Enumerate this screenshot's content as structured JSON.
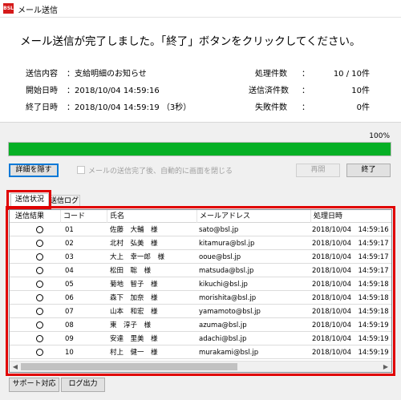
{
  "window": {
    "title": "メール送信",
    "app_icon_text": "BSL"
  },
  "message": {
    "complete_text": "メール送信が完了しました。「終了」ボタンをクリックしてください。"
  },
  "info": {
    "content_label": "送信内容",
    "content_value": "：支給明細のお知らせ",
    "start_label": "開始日時",
    "start_value": "：2018/10/04 14:59:16",
    "end_label": "終了日時",
    "end_value": "：2018/10/04 14:59:19 （3秒）",
    "processed_label": "処理件数",
    "processed_value": "10 / 10件",
    "sent_label": "送信済件数",
    "sent_value": "10件",
    "failed_label": "失敗件数",
    "failed_value": "0件",
    "colon": "："
  },
  "progress": {
    "percent_label": "100%",
    "value": 1.0,
    "fill_color": "#06b025"
  },
  "buttons": {
    "hide_details": "詳細を隠す",
    "resume": "再開",
    "finish": "終了",
    "support": "サポート対応",
    "log_output": "ログ出力"
  },
  "auto_close": {
    "label": "メールの送信完了後、自動的に画面を閉じる",
    "checked": false
  },
  "tabs": [
    {
      "label": "送信状況",
      "active": true
    },
    {
      "label": "送信ログ",
      "active": false
    }
  ],
  "table": {
    "columns": [
      "送信結果",
      "コード",
      "氏名",
      "メールアドレス",
      "処理日時"
    ],
    "rows": [
      {
        "result": "○",
        "code": "01",
        "name": "佐藤　大輔　様",
        "email": "sato@bsl.jp",
        "time": "2018/10/04　14:59:16"
      },
      {
        "result": "○",
        "code": "02",
        "name": "北村　弘美　様",
        "email": "kitamura@bsl.jp",
        "time": "2018/10/04　14:59:17"
      },
      {
        "result": "○",
        "code": "03",
        "name": "大上　幸一郎　様",
        "email": "ooue@bsl.jp",
        "time": "2018/10/04　14:59:17"
      },
      {
        "result": "○",
        "code": "04",
        "name": "松田　聡　様",
        "email": "matsuda@bsl.jp",
        "time": "2018/10/04　14:59:17"
      },
      {
        "result": "○",
        "code": "05",
        "name": "菊地　智子　様",
        "email": "kikuchi@bsl.jp",
        "time": "2018/10/04　14:59:18"
      },
      {
        "result": "○",
        "code": "06",
        "name": "森下　加奈　様",
        "email": "morishita@bsl.jp",
        "time": "2018/10/04　14:59:18"
      },
      {
        "result": "○",
        "code": "07",
        "name": "山本　和宏　様",
        "email": "yamamoto@bsl.jp",
        "time": "2018/10/04　14:59:18"
      },
      {
        "result": "○",
        "code": "08",
        "name": "東　淳子　様",
        "email": "azuma@bsl.jp",
        "time": "2018/10/04　14:59:19"
      },
      {
        "result": "○",
        "code": "09",
        "name": "安達　里美　様",
        "email": "adachi@bsl.jp",
        "time": "2018/10/04　14:59:19"
      },
      {
        "result": "○",
        "code": "10",
        "name": "村上　健一　様",
        "email": "murakami@bsl.jp",
        "time": "2018/10/04　14:59:19"
      }
    ]
  },
  "colors": {
    "highlight": "#e00000",
    "accent": "#0078d7"
  }
}
